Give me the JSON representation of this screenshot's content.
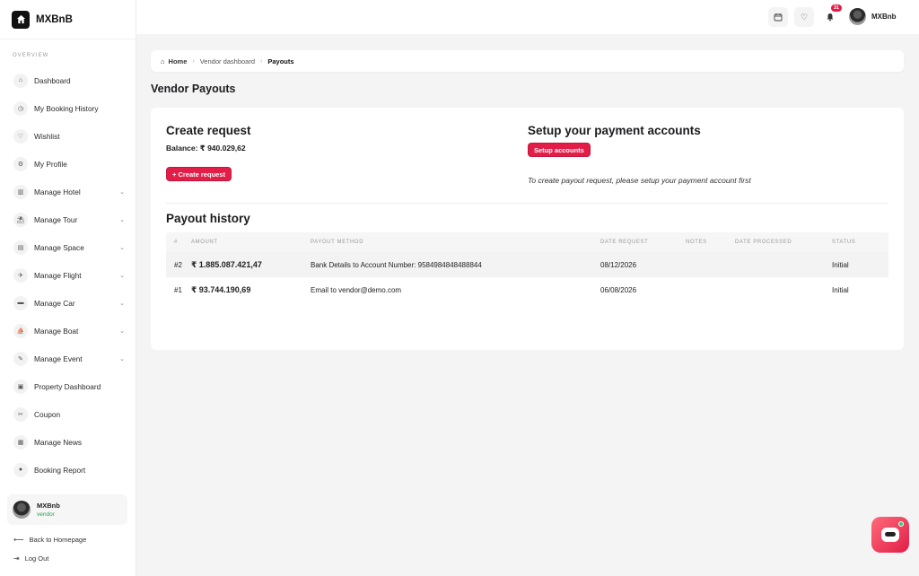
{
  "brand": {
    "name": "MXBnB"
  },
  "sidebar": {
    "section": "OVERVIEW",
    "items": [
      {
        "label": "Dashboard",
        "icon": "home-icon",
        "glyph": "⌂",
        "chevron": false
      },
      {
        "label": "My Booking History",
        "icon": "clock-icon",
        "glyph": "◷",
        "chevron": false
      },
      {
        "label": "Wishlist",
        "icon": "heart-icon",
        "glyph": "♡",
        "chevron": false
      },
      {
        "label": "My Profile",
        "icon": "settings-icon",
        "glyph": "⚙",
        "chevron": false
      },
      {
        "label": "Manage Hotel",
        "icon": "building-icon",
        "glyph": "▥",
        "chevron": true
      },
      {
        "label": "Manage Tour",
        "icon": "tour-icon",
        "glyph": "⛱",
        "chevron": true
      },
      {
        "label": "Manage Space",
        "icon": "space-icon",
        "glyph": "▤",
        "chevron": true
      },
      {
        "label": "Manage Flight",
        "icon": "plane-icon",
        "glyph": "✈",
        "chevron": true
      },
      {
        "label": "Manage Car",
        "icon": "car-icon",
        "glyph": "▬",
        "chevron": true
      },
      {
        "label": "Manage Boat",
        "icon": "boat-icon",
        "glyph": "⛵",
        "chevron": true
      },
      {
        "label": "Manage Event",
        "icon": "ticket-icon",
        "glyph": "✎",
        "chevron": true
      },
      {
        "label": "Property Dashboard",
        "icon": "clipboard-icon",
        "glyph": "▣",
        "chevron": false
      },
      {
        "label": "Coupon",
        "icon": "coupon-icon",
        "glyph": "✂",
        "chevron": false
      },
      {
        "label": "Manage News",
        "icon": "news-icon",
        "glyph": "▦",
        "chevron": false
      },
      {
        "label": "Booking Report",
        "icon": "report-icon",
        "glyph": "●",
        "chevron": false
      }
    ],
    "user": {
      "name": "MXBnb",
      "role": "vendor"
    },
    "back_link": "Back to Homepage",
    "logout": "Log Out"
  },
  "topbar": {
    "notification_count": "31",
    "user_name": "MXBnb"
  },
  "breadcrumb": {
    "home": "Home",
    "parent": "Vendor dashboard",
    "current": "Payouts"
  },
  "page": {
    "title": "Vendor Payouts"
  },
  "create_request": {
    "title": "Create request",
    "balance": "Balance: ₹ 940.029,62",
    "button": "+ Create request"
  },
  "setup": {
    "title": "Setup your payment accounts",
    "button": "Setup accounts",
    "note": "To create payout request, please setup your payment account first"
  },
  "history": {
    "title": "Payout history",
    "columns": [
      "#",
      "AMOUNT",
      "PAYOUT METHOD",
      "DATE REQUEST",
      "NOTES",
      "DATE PROCESSED",
      "STATUS"
    ],
    "rows": [
      {
        "id": "#2",
        "amount": "₹ 1.885.087.421,47",
        "method": "Bank Details to Account Number: 9584984848488844",
        "date": "08/12/2026",
        "notes": "",
        "processed": "",
        "status": "Initial"
      },
      {
        "id": "#1",
        "amount": "₹ 93.744.190,69",
        "method": "Email to vendor@demo.com",
        "date": "06/08/2026",
        "notes": "",
        "processed": "",
        "status": "Initial"
      }
    ]
  },
  "colors": {
    "accent": "#e11d48",
    "success": "#23a455"
  }
}
